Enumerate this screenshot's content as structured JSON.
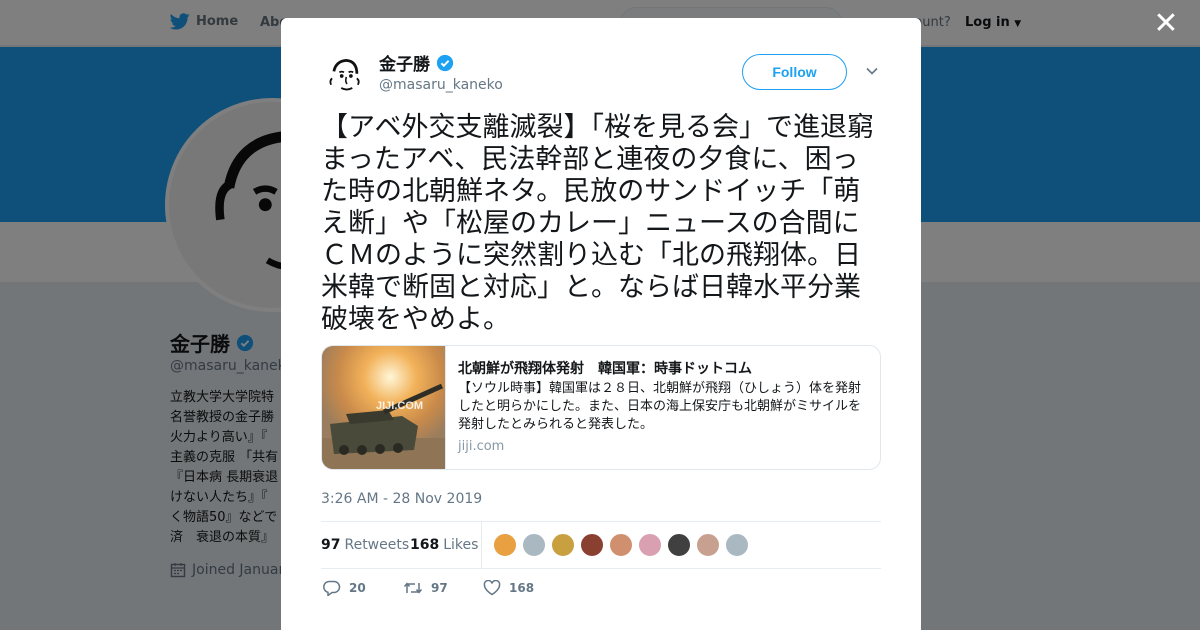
{
  "background": {
    "nav": {
      "home_label": "Home",
      "about_label": "Abo",
      "account_prompt": "ccount?",
      "login_label": "Log in"
    },
    "profile": {
      "name": "金子勝",
      "handle": "@masaru_kaneko",
      "bio": "立教大学大学院特\n名誉教授の金子勝\n火力より高い』『\n主義の克服 「共有\n『日本病 長期衰退\nけない人たち』『\nく物語50』などで\n済　衰退の本質』",
      "joined": "Joined Januar"
    }
  },
  "modal": {
    "author": {
      "name": "金子勝",
      "handle": "@masaru_kaneko",
      "verified": true
    },
    "follow_label": "Follow",
    "tweet_text": "【アベ外交支離滅裂】「桜を見る会」で進退窮まったアベ、民法幹部と連夜の夕食に、困った時の北朝鮮ネタ。民放のサンドイッチ「萌え断」や「松屋のカレー」ニュースの合間にＣＭのように突然割り込む「北の飛翔体。日米韓で断固と対応」と。ならば日韓水平分業破壊をやめよ。",
    "card": {
      "image_watermark": "JIJI.COM",
      "title": "北朝鮮が飛翔体発射　韓国軍：時事ドットコム",
      "description": "【ソウル時事】韓国軍は２８日、北朝鮮が飛翔（ひしょう）体を発射したと明らかにした。また、日本の海上保安庁も北朝鮮がミサイルを発射したとみられると発表した。",
      "domain": "jiji.com"
    },
    "timestamp": "3:26 AM - 28 Nov 2019",
    "stats": {
      "retweets_count": "97",
      "retweets_label": "Retweets",
      "likes_count": "168",
      "likes_label": "Likes"
    },
    "liker_colors": [
      "#e8a040",
      "#aab8c2",
      "#c9a040",
      "#8a4030",
      "#d09070",
      "#d8a0b0",
      "#404040",
      "#c8a090",
      "#aab8c2"
    ],
    "actions": {
      "reply_count": "20",
      "retweet_count": "97",
      "like_count": "168"
    }
  },
  "colors": {
    "brand": "#1da1f2",
    "overlay": "rgba(0,0,0,0.5)",
    "muted": "#657786"
  }
}
